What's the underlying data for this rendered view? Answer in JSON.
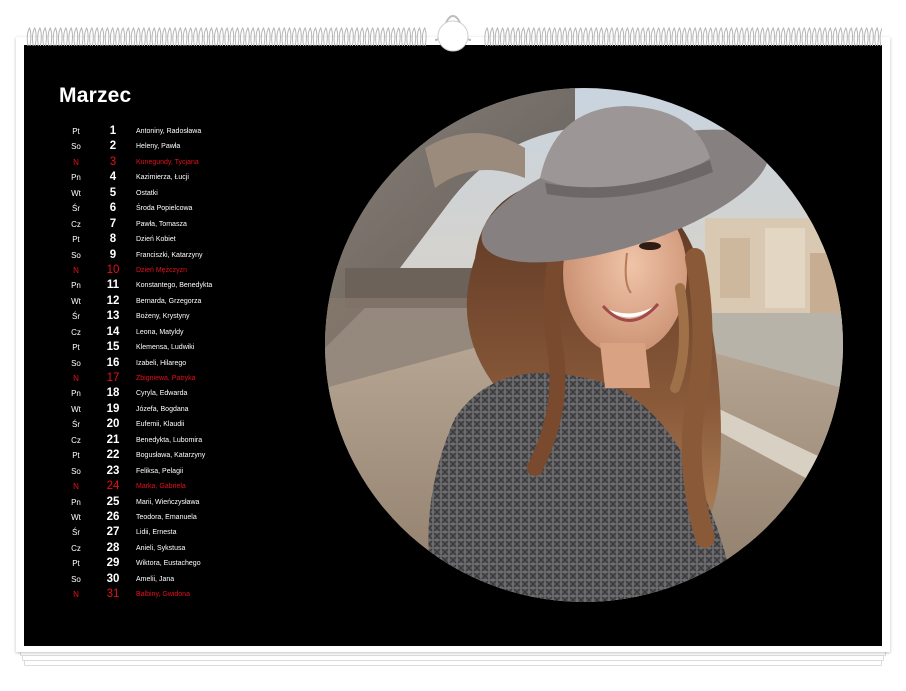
{
  "calendar": {
    "month": "Marzec",
    "days": [
      {
        "dow": "Pt",
        "num": "1",
        "names": "Antoniny, Radosława",
        "sunday": false
      },
      {
        "dow": "So",
        "num": "2",
        "names": "Heleny, Pawła",
        "sunday": false
      },
      {
        "dow": "N",
        "num": "3",
        "names": "Kunegundy, Tycjana",
        "sunday": true
      },
      {
        "dow": "Pn",
        "num": "4",
        "names": "Kazimierza, Łucji",
        "sunday": false
      },
      {
        "dow": "Wt",
        "num": "5",
        "names": "Ostatki",
        "sunday": false
      },
      {
        "dow": "Śr",
        "num": "6",
        "names": "Środa Popielcowa",
        "sunday": false
      },
      {
        "dow": "Cz",
        "num": "7",
        "names": "Pawła, Tomasza",
        "sunday": false
      },
      {
        "dow": "Pt",
        "num": "8",
        "names": "Dzień Kobiet",
        "sunday": false
      },
      {
        "dow": "So",
        "num": "9",
        "names": "Franciszki, Katarzyny",
        "sunday": false
      },
      {
        "dow": "N",
        "num": "10",
        "names": "Dzień Mężczyzn",
        "sunday": true
      },
      {
        "dow": "Pn",
        "num": "11",
        "names": "Konstantego, Benedykta",
        "sunday": false
      },
      {
        "dow": "Wt",
        "num": "12",
        "names": "Bernarda, Grzegorza",
        "sunday": false
      },
      {
        "dow": "Śr",
        "num": "13",
        "names": "Bożeny, Krystyny",
        "sunday": false
      },
      {
        "dow": "Cz",
        "num": "14",
        "names": "Leona, Matyldy",
        "sunday": false
      },
      {
        "dow": "Pt",
        "num": "15",
        "names": "Klemensa, Ludwiki",
        "sunday": false
      },
      {
        "dow": "So",
        "num": "16",
        "names": "Izabeli, Hilarego",
        "sunday": false
      },
      {
        "dow": "N",
        "num": "17",
        "names": "Zbigniewa, Patryka",
        "sunday": true
      },
      {
        "dow": "Pn",
        "num": "18",
        "names": "Cyryla, Edwarda",
        "sunday": false
      },
      {
        "dow": "Wt",
        "num": "19",
        "names": "Józefa, Bogdana",
        "sunday": false
      },
      {
        "dow": "Śr",
        "num": "20",
        "names": "Eufemii, Klaudii",
        "sunday": false
      },
      {
        "dow": "Cz",
        "num": "21",
        "names": "Benedykta, Lubomira",
        "sunday": false
      },
      {
        "dow": "Pt",
        "num": "22",
        "names": "Bogusława, Katarzyny",
        "sunday": false
      },
      {
        "dow": "So",
        "num": "23",
        "names": "Feliksa, Pelagii",
        "sunday": false
      },
      {
        "dow": "N",
        "num": "24",
        "names": "Marka, Gabriela",
        "sunday": true
      },
      {
        "dow": "Pn",
        "num": "25",
        "names": "Marii, Wieńczysława",
        "sunday": false
      },
      {
        "dow": "Wt",
        "num": "26",
        "names": "Teodora, Emanuela",
        "sunday": false
      },
      {
        "dow": "Śr",
        "num": "27",
        "names": "Lidii, Ernesta",
        "sunday": false
      },
      {
        "dow": "Cz",
        "num": "28",
        "names": "Anieli, Sykstusa",
        "sunday": false
      },
      {
        "dow": "Pt",
        "num": "29",
        "names": "Wiktora, Eustachego",
        "sunday": false
      },
      {
        "dow": "So",
        "num": "30",
        "names": "Amelii, Jana",
        "sunday": false
      },
      {
        "dow": "N",
        "num": "31",
        "names": "Balbiny, Gwidona",
        "sunday": true
      }
    ]
  },
  "colors": {
    "background": "#000000",
    "text": "#ffffff",
    "holiday": "#e3101d"
  },
  "icons": {
    "binding": "spiral-wire-binding",
    "hanger": "calendar-hanger-hook"
  }
}
